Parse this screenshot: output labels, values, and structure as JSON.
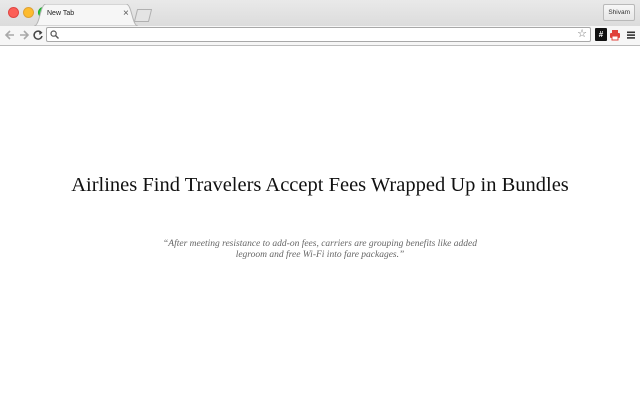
{
  "browser": {
    "tabs": [
      {
        "title": "New Tab",
        "close_glyph": "×",
        "active": true
      }
    ],
    "profile_name": "Shivam",
    "omnibox": {
      "value": "",
      "placeholder": ""
    },
    "extensions": {
      "hash_label": "#"
    },
    "icons": {
      "back": "back-arrow-icon",
      "forward": "forward-arrow-icon",
      "reload": "reload-icon",
      "search": "search-icon",
      "bookmark": "star-icon",
      "print": "print-icon",
      "menu": "hamburger-menu-icon"
    },
    "colors": {
      "close": "#fc5f57",
      "minimize": "#fdbb2d",
      "zoom": "#28c840",
      "print_extension": "#e0413b"
    }
  },
  "article": {
    "headline": "Airlines Find Travelers Accept Fees Wrapped Up in Bundles",
    "summary": "“After meeting resistance to add-on fees, carriers are grouping benefits like added legroom and free Wi-Fi into fare packages.”"
  }
}
